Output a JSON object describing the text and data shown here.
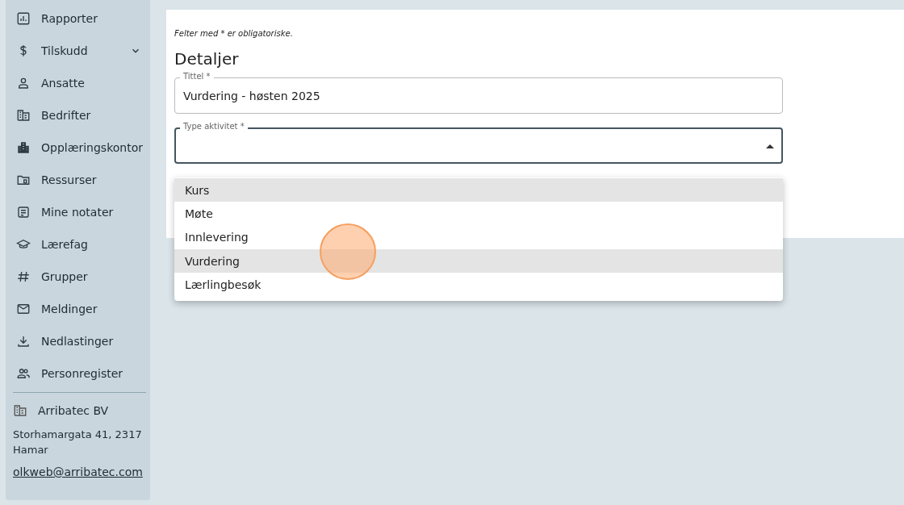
{
  "sidebar": {
    "items": [
      {
        "label": "Rapporter",
        "expandable": false
      },
      {
        "label": "Tilskudd",
        "expandable": true
      },
      {
        "label": "Ansatte",
        "expandable": false
      },
      {
        "label": "Bedrifter",
        "expandable": false
      },
      {
        "label": "Opplæringskontor",
        "expandable": false
      },
      {
        "label": "Ressurser",
        "expandable": false
      },
      {
        "label": "Mine notater",
        "expandable": false
      },
      {
        "label": "Lærefag",
        "expandable": false
      },
      {
        "label": "Grupper",
        "expandable": false
      },
      {
        "label": "Meldinger",
        "expandable": false
      },
      {
        "label": "Nedlastinger",
        "expandable": false
      },
      {
        "label": "Personregister",
        "expandable": false
      }
    ],
    "company": {
      "name": "Arribatec BV",
      "address": "Storhamargata 41, 2317 Hamar",
      "email": "olkweb@arribatec.com"
    }
  },
  "form": {
    "note": "Felter med * er obligatoriske.",
    "heading": "Detaljer",
    "fields": [
      {
        "kind": "text",
        "label": "Tittel *",
        "value": "Vurdering - høsten 2025",
        "focused": false
      },
      {
        "kind": "select",
        "label": "Type aktivitet *",
        "focused": true,
        "expanded": true
      }
    ],
    "options": [
      {
        "label": "Kurs",
        "highlighted": true
      },
      {
        "label": "Møte",
        "highlighted": false
      },
      {
        "label": "Innlevering",
        "highlighted": false
      },
      {
        "label": "Vurdering",
        "highlighted": true
      },
      {
        "label": "Lærlingbesøk",
        "highlighted": false
      }
    ]
  },
  "click_indicator": true
}
